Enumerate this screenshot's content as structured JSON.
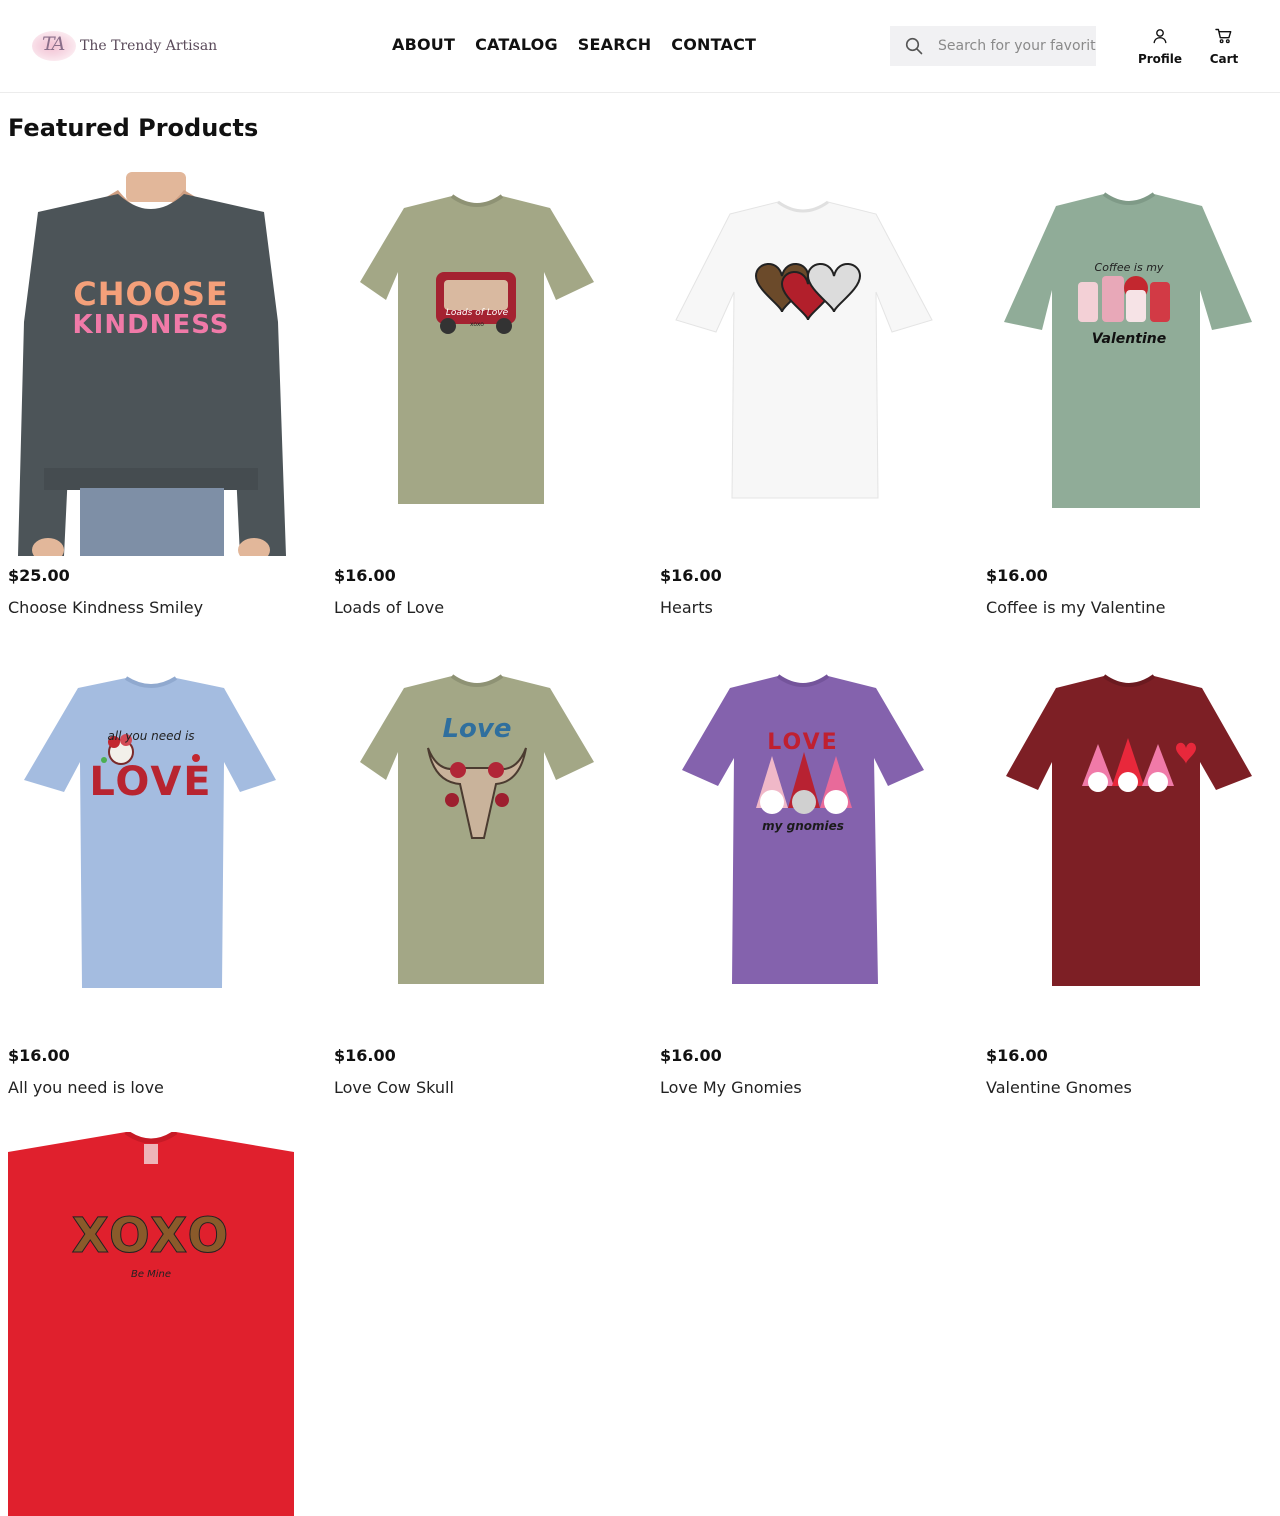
{
  "header": {
    "brand": "The Trendy Artisan",
    "brand_mark": "TA",
    "nav": [
      {
        "label": "ABOUT"
      },
      {
        "label": "CATALOG"
      },
      {
        "label": "SEARCH"
      },
      {
        "label": "CONTACT"
      }
    ],
    "search": {
      "placeholder": "Search for your favorites"
    },
    "profile_label": "Profile",
    "cart_label": "Cart"
  },
  "main": {
    "section_title": "Featured Products",
    "products": [
      {
        "price": "$25.00",
        "name": "Choose Kindness Smiley",
        "garment": "sweatshirt",
        "color": "#4c5458",
        "print": [
          "CHOOSE",
          "KINDNESS"
        ]
      },
      {
        "price": "$16.00",
        "name": "Loads of Love",
        "garment": "tee",
        "color": "#a3a786",
        "print": [
          "Loads of Love",
          "xoxo"
        ]
      },
      {
        "price": "$16.00",
        "name": "Hearts",
        "garment": "tee",
        "color": "#f7f7f7",
        "print": []
      },
      {
        "price": "$16.00",
        "name": "Coffee is my Valentine",
        "garment": "tee",
        "color": "#90ac98",
        "print": [
          "Coffee is my",
          "Valentine"
        ]
      },
      {
        "price": "$16.00",
        "name": "All you need is love",
        "garment": "tee",
        "color": "#a4bce0",
        "print": [
          "all you need is",
          "LOVE"
        ]
      },
      {
        "price": "$16.00",
        "name": "Love Cow Skull",
        "garment": "tee",
        "color": "#a3a786",
        "print": [
          "Love"
        ]
      },
      {
        "price": "$16.00",
        "name": "Love My Gnomies",
        "garment": "tee",
        "color": "#8462ad",
        "print": [
          "LOVE",
          "my gnomies"
        ]
      },
      {
        "price": "$16.00",
        "name": "Valentine Gnomes",
        "garment": "tee",
        "color": "#7d1f25",
        "print": []
      },
      {
        "price": "",
        "name": "",
        "garment": "tee",
        "color": "#e0202d",
        "print": [
          "XOXO",
          "Be Mine"
        ]
      }
    ]
  }
}
